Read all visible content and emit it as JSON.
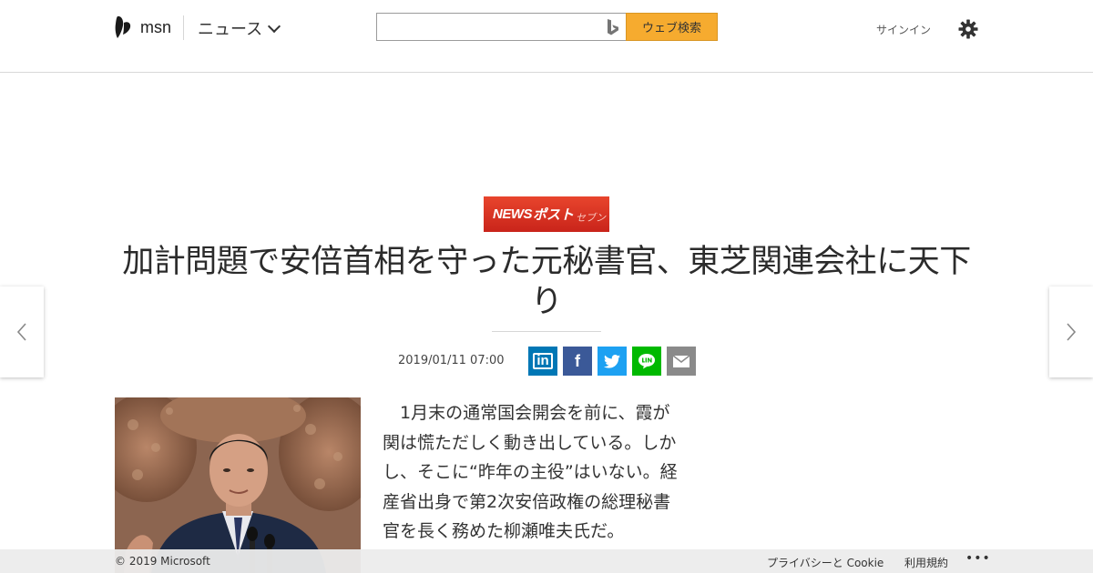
{
  "header": {
    "logo_text": "msn",
    "nav_label": "ニュース",
    "search_placeholder": "",
    "search_button": "ウェブ検索",
    "signin": "サインイン"
  },
  "source": {
    "part1": "NEWS",
    "part2": "ポスト",
    "part3": "セブン"
  },
  "article": {
    "title": "加計問題で安倍首相を守った元秘書官、東芝関連会社に天下り",
    "date": "2019/01/11 07:00",
    "body": "1月末の通常国会開会を前に、霞が関は慌ただしく動き出している。しかし、そこに“昨年の主役”はいない。経産省出身で第2次安倍政権の総理秘書官を長く務めた柳瀬唯夫氏だ。"
  },
  "share": {
    "linkedin": "in",
    "facebook": "f"
  },
  "footer": {
    "copyright": "© 2019 Microsoft",
    "privacy": "プライバシーと Cookie",
    "terms": "利用規約",
    "more": "•••"
  },
  "colors": {
    "search_button": "#f6ab2f",
    "linkedin": "#0077b5",
    "facebook": "#3b5998",
    "twitter": "#1da1f2",
    "line": "#00b900",
    "mail": "#8a8a8a"
  }
}
